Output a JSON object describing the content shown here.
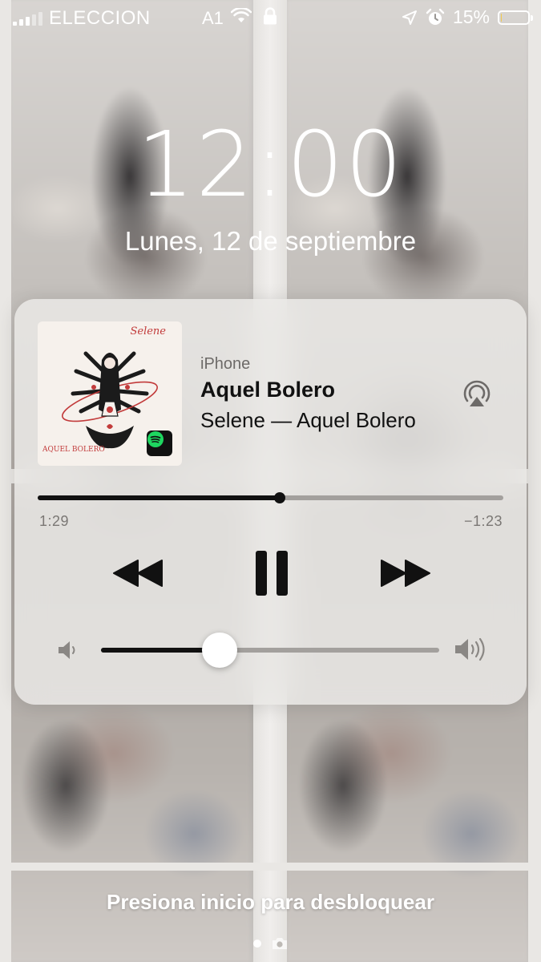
{
  "status_bar": {
    "carrier": "ELECCION",
    "network": "A1",
    "battery_percent": "15%",
    "battery_level": 0.15,
    "battery_color": "#f2c94c",
    "icons": [
      "signal-icon",
      "wifi-icon",
      "lock-icon",
      "location-arrow-icon",
      "alarm-icon",
      "battery-icon"
    ]
  },
  "lock_screen": {
    "time": "12:00",
    "date": "Lunes, 12 de septiembre",
    "unlock_hint": "Presiona inicio para desbloquear"
  },
  "now_playing": {
    "source": "iPhone",
    "title": "Aquel Bolero",
    "subtitle": "Selene — Aquel Bolero",
    "artwork": {
      "artist_script": "Selene",
      "title_script": "AQUEL BOLERO",
      "app_badge": "spotify-icon",
      "badge_color": "#1ed760"
    },
    "elapsed": "1:29",
    "remaining": "−1:23",
    "progress_fraction": 0.52,
    "volume_fraction": 0.35,
    "controls": {
      "rewind": "rewind-icon",
      "play_pause": "pause-icon",
      "forward": "fast-forward-icon",
      "airplay": "airplay-icon",
      "volume_min": "speaker-low-icon",
      "volume_max": "speaker-high-icon"
    }
  },
  "page_indicator": {
    "pages": 1,
    "active": 0,
    "extra": "camera-icon"
  }
}
